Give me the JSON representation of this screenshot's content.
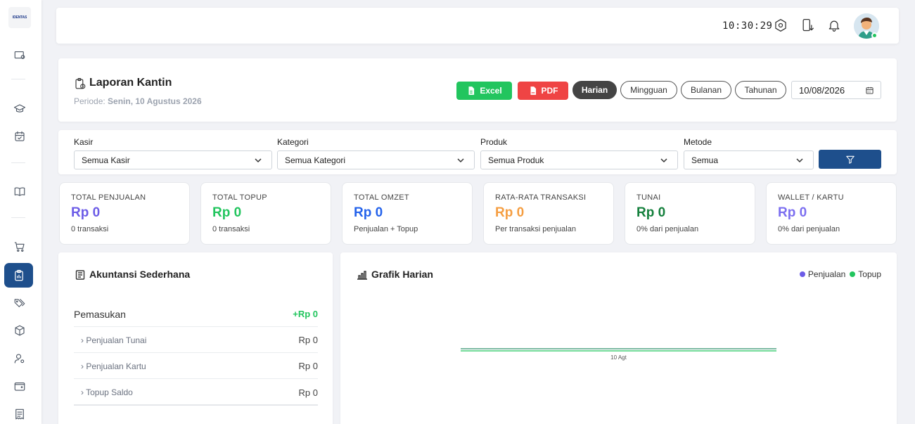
{
  "sidebar": {
    "logo_text": "IDENTAS"
  },
  "topbar": {
    "clock": "10:30:29"
  },
  "header": {
    "title": "Laporan Kantin",
    "periode_label": "Periode:",
    "periode_value": "Senin, 10 Agustus 2026",
    "excel_label": "Excel",
    "pdf_label": "PDF",
    "period_tabs": [
      "Harian",
      "Mingguan",
      "Bulanan",
      "Tahunan"
    ],
    "active_tab": "Harian",
    "date_value": "10/08/2026"
  },
  "filters": {
    "kasir_label": "Kasir",
    "kasir_value": "Semua Kasir",
    "kategori_label": "Kategori",
    "kategori_value": "Semua Kategori",
    "produk_label": "Produk",
    "produk_value": "Semua Produk",
    "metode_label": "Metode",
    "metode_value": "Semua"
  },
  "stats": [
    {
      "label": "TOTAL PENJUALAN",
      "value": "Rp 0",
      "sub": "0 transaksi",
      "color": "#6c5ce7"
    },
    {
      "label": "TOTAL TOPUP",
      "value": "Rp 0",
      "sub": "0 transaksi",
      "color": "#22c55e"
    },
    {
      "label": "TOTAL OMZET",
      "value": "Rp 0",
      "sub": "Penjualan + Topup",
      "color": "#2563eb"
    },
    {
      "label": "RATA-RATA TRANSAKSI",
      "value": "Rp 0",
      "sub": "Per transaksi penjualan",
      "color": "#f59e42"
    },
    {
      "label": "TUNAI",
      "value": "Rp 0",
      "sub": "0% dari penjualan",
      "color": "#15803d"
    },
    {
      "label": "WALLET / KARTU",
      "value": "Rp 0",
      "sub": "0% dari penjualan",
      "color": "#7c6ff0"
    }
  ],
  "accounting": {
    "title": "Akuntansi Sederhana",
    "pemasukan_label": "Pemasukan",
    "pemasukan_value": "+Rp 0",
    "rows": [
      {
        "label": "› Penjualan Tunai",
        "value": "Rp 0"
      },
      {
        "label": "› Penjualan Kartu",
        "value": "Rp 0"
      },
      {
        "label": "› Topup Saldo",
        "value": "Rp 0"
      }
    ]
  },
  "chart_card": {
    "title": "Grafik Harian",
    "legend": [
      {
        "name": "Penjualan",
        "color": "#6c5ce7"
      },
      {
        "name": "Topup",
        "color": "#22c55e"
      }
    ]
  },
  "chart_data": {
    "type": "line",
    "title": "Grafik Harian",
    "categories": [
      "10 Agt"
    ],
    "series": [
      {
        "name": "Penjualan",
        "values": [
          0
        ],
        "color": "#6c5ce7"
      },
      {
        "name": "Topup",
        "values": [
          0
        ],
        "color": "#22c55e"
      }
    ],
    "grid": false,
    "legend": "top-right"
  }
}
